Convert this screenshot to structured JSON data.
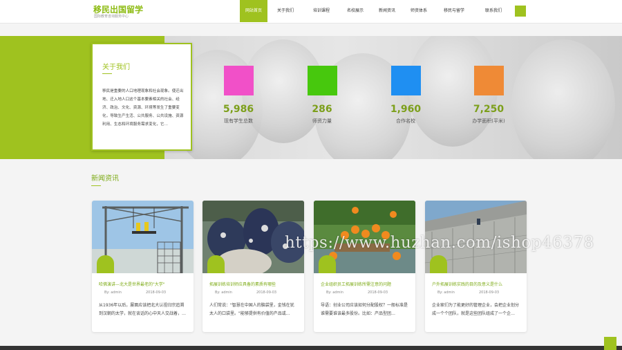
{
  "header": {
    "logo_title": "移民出国留学",
    "logo_sub": "国际教育咨询服务中心",
    "nav": [
      {
        "label": "网站首页",
        "active": true
      },
      {
        "label": "关于我们"
      },
      {
        "label": "培训课程"
      },
      {
        "label": "名校展示"
      },
      {
        "label": "新闻资讯"
      },
      {
        "label": "师资体系"
      },
      {
        "label": "移民与留学"
      },
      {
        "label": "联系我们"
      }
    ],
    "accent_color": "#9fc21f"
  },
  "about": {
    "title": "关于我们",
    "text": "移民是重要的人口地理现象和社会现象。使迁出地、迁入地人口这个基本要素相关的社会、经济、政治、文化、资源、环境等发生了重要变化，导致生产生活、公共服务、公共设施、资源利用、生态和环境服务需求变化，它…"
  },
  "stats": [
    {
      "value": "5,986",
      "label": "现有学生总数",
      "color": "#f150c8"
    },
    {
      "value": "286",
      "label": "师资力量",
      "color": "#47c80d"
    },
    {
      "value": "1,960",
      "label": "合作名校",
      "color": "#1f8ff2"
    },
    {
      "value": "7,250",
      "label": "办学面积(平米)",
      "color": "#ef8a36"
    }
  ],
  "news": {
    "title": "新闻资讯",
    "items": [
      {
        "title": "哈佛演讲—北大是世界最老的\"大学\"",
        "author": "By: admin",
        "date": "2018-09-03",
        "desc": "从1936年以后，屡面应该把北大认祖归宗追溯到汉朝的太学，就在谈话的心中天人交战着，…"
      },
      {
        "title": "拓展训练培训师应具备的素质有哪些",
        "author": "By: admin",
        "date": "2018-09-03",
        "desc": "人们常说：\"智慧在中国人的脑袋里，金钱在犹太人的口袋里。\"能够提供有价值的产品或…"
      },
      {
        "title": "企业组织员工拓展训练所需注意的问题",
        "author": "By: admin",
        "date": "2018-09-03",
        "desc": "导语：创业公司应该如何分配股权？一般标准是谁需要谁该最多股份。比如：产品型团…"
      },
      {
        "title": "户外拓展训练实践的目的及意义是什么",
        "author": "By: admin",
        "date": "2018-09-03",
        "desc": "企业家们为了能更好的管理企业，会把企业划分成一个个团队，就是这些团队组成了一个企…"
      }
    ]
  },
  "watermark": "https://www.huzhan.com/ishop46378"
}
